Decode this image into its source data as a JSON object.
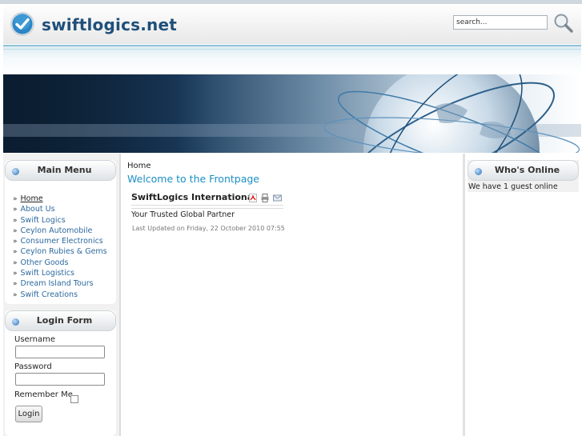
{
  "header": {
    "site_name": "swiftlogics.net",
    "search_value": "search...",
    "logo_icon": "checkmark-badge-icon",
    "search_icon": "magnifier-icon"
  },
  "colors": {
    "brand": "#1f4f7a",
    "link": "#2c6a9f",
    "title": "#1b8fc4",
    "accent_line": "#8fc3d8"
  },
  "main_menu": {
    "title": "Main Menu",
    "items": [
      {
        "label": "Home"
      },
      {
        "label": "About Us"
      },
      {
        "label": "Swift Logics"
      },
      {
        "label": "Ceylon Automobile"
      },
      {
        "label": "Consumer Electronics"
      },
      {
        "label": "Ceylon Rubies & Gems"
      },
      {
        "label": "Other Goods"
      },
      {
        "label": "Swift Logistics"
      },
      {
        "label": "Dream Island Tours"
      },
      {
        "label": "Swift Creations"
      }
    ],
    "bullet": "»"
  },
  "login_form": {
    "title": "Login Form",
    "username_label": "Username",
    "password_label": "Password",
    "remember_label": "Remember Me",
    "button_label": "Login"
  },
  "content": {
    "breadcrumb": "Home",
    "page_title": "Welcome to the Frontpage",
    "article_title": "SwiftLogics International",
    "tool_icons": [
      "pdf-icon",
      "print-icon",
      "email-icon"
    ],
    "subtitle": "Your Trusted Global Partner",
    "updated": "Last Updated on Friday, 22 October 2010 07:55"
  },
  "whos_online": {
    "title": "Who's Online",
    "text": "We have 1 guest online"
  }
}
